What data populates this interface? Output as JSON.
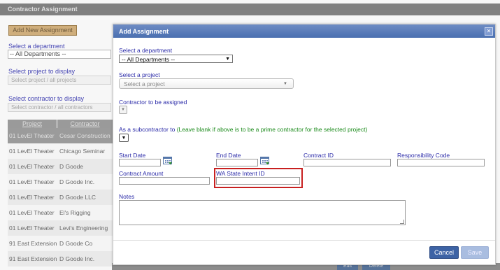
{
  "background": {
    "title": "Contractor Assignment",
    "add_new_button": "Add New Assignment",
    "department_label": "Select a department",
    "department_value": "-- All Departments --",
    "project_label": "Select project to display",
    "project_placeholder": "Select project / all projects",
    "contractor_label": "Select contractor to display",
    "contractor_placeholder": "Select contractor / all contractors",
    "grid_headers": [
      "Project",
      "Contractor"
    ],
    "rows": [
      {
        "project": "01 LevEl Theater",
        "contractor": "Cesar Construction"
      },
      {
        "project": "01 LevEl Theater",
        "contractor": "Chicago Seminar"
      },
      {
        "project": "01 LevEl Theater",
        "contractor": "D Goode"
      },
      {
        "project": "01 LevEl Theater",
        "contractor": "D Goode Inc."
      },
      {
        "project": "01 LevEl Theater",
        "contractor": "D Goode LLC"
      },
      {
        "project": "01 LevEl Theater",
        "contractor": "El's Rigging"
      },
      {
        "project": "01 LevEl Theater",
        "contractor": "Levi's Engineering"
      },
      {
        "project": "91 East Extension",
        "contractor": "D Goode Co"
      },
      {
        "project": "91 East Extension",
        "contractor": "D Goode Inc."
      }
    ],
    "row_buttons": [
      "Edit",
      "Delete"
    ]
  },
  "modal": {
    "title": "Add Assignment",
    "close_icon": "close-icon",
    "department_label": "Select a department",
    "department_value": "-- All Departments --",
    "project_label": "Select a project",
    "project_placeholder": "Select a project",
    "contractor_label": "Contractor to be assigned",
    "subcontractor_label": "As a subcontractor to",
    "subcontractor_note": "(Leave blank if above is to be a prime contractor for the selected project)",
    "start_date_label": "Start Date",
    "end_date_label": "End Date",
    "contract_id_label": "Contract ID",
    "responsibility_code_label": "Responsibility Code",
    "contract_amount_label": "Contract Amount",
    "wa_state_label": "WA State Intent ID",
    "notes_label": "Notes",
    "cancel_button": "Cancel",
    "save_button": "Save"
  },
  "colors": {
    "header_blue": "#4a6fb0",
    "label_blue": "#2a2aa8",
    "note_green": "#1a8a1a",
    "highlight_red": "#c82020"
  }
}
